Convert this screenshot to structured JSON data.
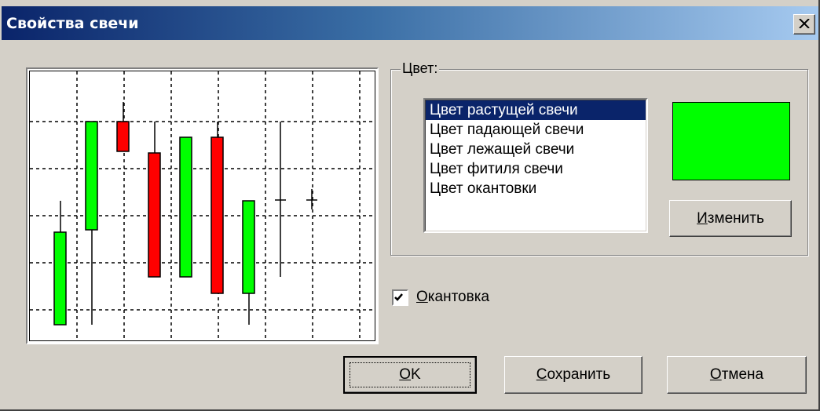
{
  "window": {
    "title": "Свойства свечи"
  },
  "color_group": {
    "legend": "Цвет:",
    "items": [
      "Цвет растущей свечи",
      "Цвет падающей свечи",
      "Цвет лежащей свечи",
      "Цвет фитиля свечи",
      "Цвет окантовки"
    ],
    "selected_index": 0,
    "swatch_color": "#00ff00",
    "change_button": {
      "accel": "И",
      "rest": "зменить"
    }
  },
  "border_checkbox": {
    "checked": true,
    "accel": "О",
    "rest": "кантовка"
  },
  "buttons": {
    "ok": {
      "accel": "O",
      "rest": "K"
    },
    "save": {
      "accel": "С",
      "rest": "охранить"
    },
    "cancel": {
      "accel": "О",
      "rest": "тмена"
    }
  },
  "colors": {
    "bullish": "#00ff00",
    "bearish": "#ff0000",
    "border": "#000000"
  }
}
